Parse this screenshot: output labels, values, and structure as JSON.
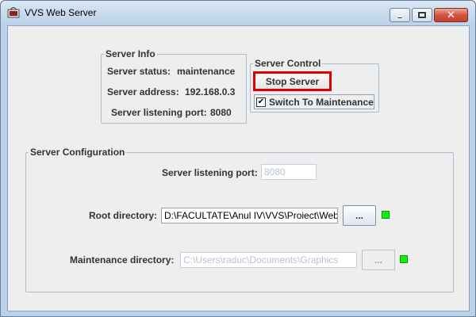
{
  "window": {
    "title": "VVS Web Server",
    "buttons": {
      "minimize": "minimize",
      "maximize": "maximize",
      "close": "close"
    }
  },
  "server_info": {
    "legend": "Server Info",
    "status_label": "Server status:",
    "status_value": "maintenance",
    "address_label": "Server address:",
    "address_value": "192.168.0.3",
    "port_label": "Server listening port:",
    "port_value": "8080"
  },
  "server_control": {
    "legend": "Server Control",
    "stop_button": "Stop Server",
    "maintenance_label": "Switch To Maintenance",
    "maintenance_checked": true,
    "check_glyph": "✔"
  },
  "server_config": {
    "legend": "Server Configuration",
    "port_label": "Server listening port:",
    "port_value": "8080",
    "root_label": "Root directory:",
    "root_value": "D:\\FACULTATE\\Anul IV\\VVS\\Proiect\\Web",
    "root_browse": "...",
    "maintenance_label": "Maintenance directory:",
    "maintenance_value": "C:\\Users\\raduc\\Documents\\Graphics",
    "maintenance_browse": "...",
    "status_color": "#11ee11"
  },
  "colors": {
    "titlebar": "#c6d9ed",
    "close_button": "#c3412c",
    "highlight_border": "#e00000"
  }
}
